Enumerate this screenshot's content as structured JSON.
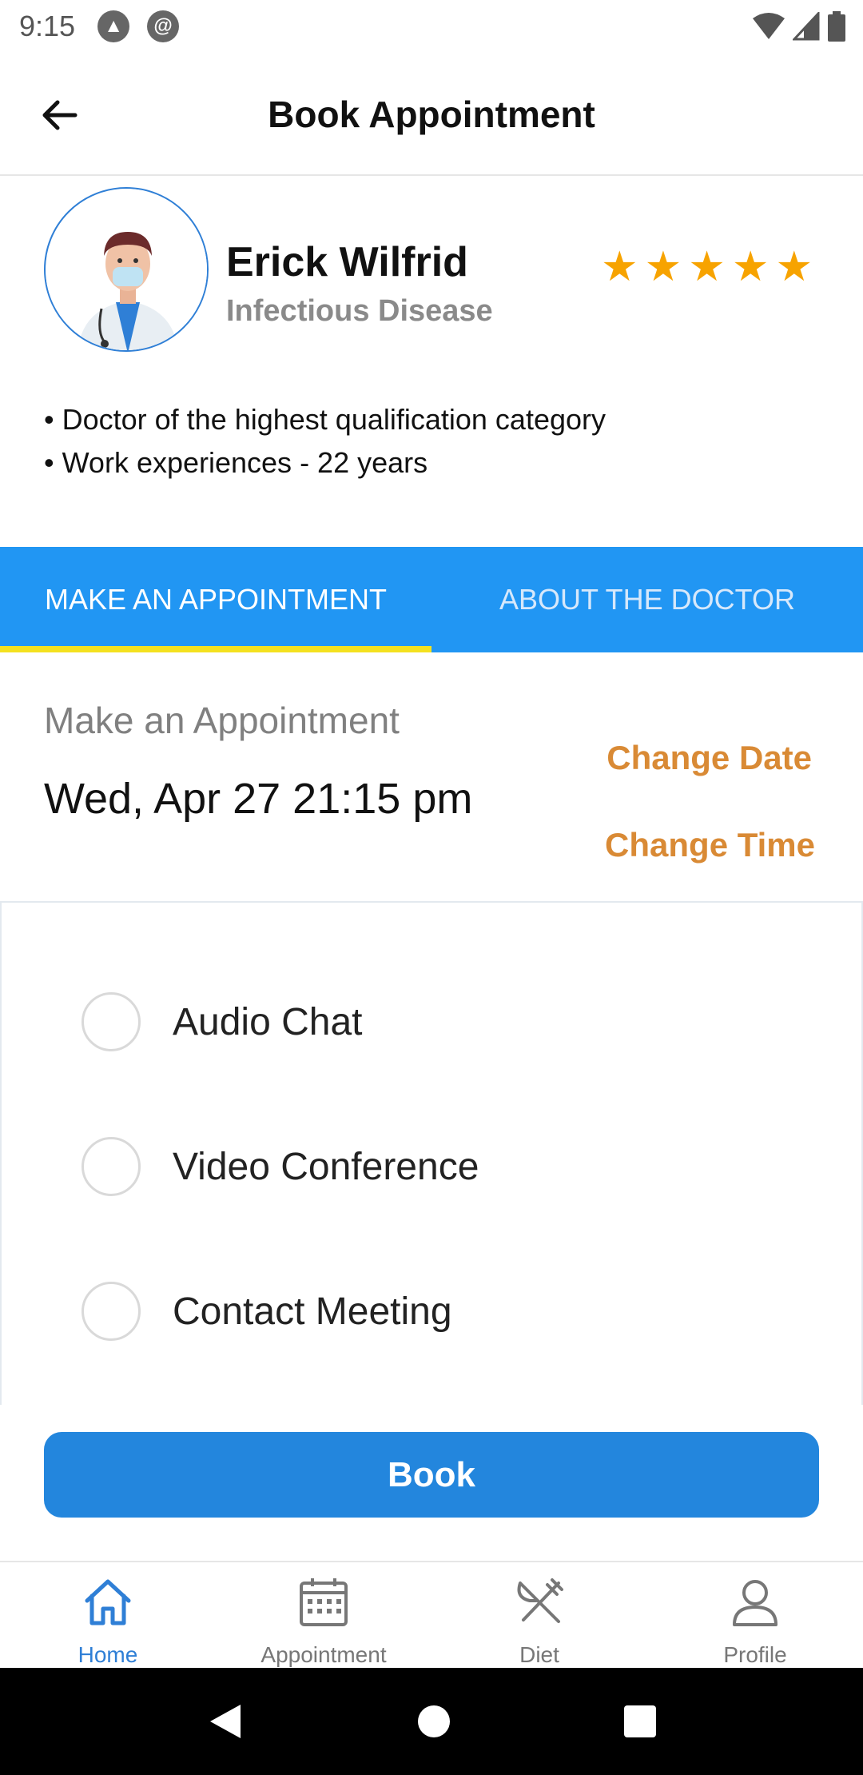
{
  "status_bar": {
    "time": "9:15"
  },
  "header": {
    "title": "Book Appointment"
  },
  "doctor": {
    "name": "Erick Wilfrid",
    "specialty": "Infectious Disease",
    "rating": 5,
    "bullets": [
      "• Doctor of the highest qualification category",
      "• Work experiences - 22 years"
    ]
  },
  "tabs": [
    {
      "label": "MAKE AN APPOINTMENT",
      "selected": true
    },
    {
      "label": "ABOUT THE DOCTOR",
      "selected": false
    }
  ],
  "appointment": {
    "heading": "Make an Appointment",
    "datetime": "Wed, Apr 27 21:15 pm",
    "change_date": "Change Date",
    "change_time": "Change Time"
  },
  "options": [
    {
      "label": "Audio Chat",
      "selected": false
    },
    {
      "label": "Video Conference",
      "selected": false
    },
    {
      "label": "Contact Meeting",
      "selected": false
    }
  ],
  "book_button": {
    "label": "Book"
  },
  "bottom_nav": [
    {
      "label": "Home",
      "icon": "home-icon",
      "active": true
    },
    {
      "label": "Appointment",
      "icon": "calendar-icon",
      "active": false
    },
    {
      "label": "Diet",
      "icon": "utensils-icon",
      "active": false
    },
    {
      "label": "Profile",
      "icon": "person-icon",
      "active": false
    }
  ],
  "colors": {
    "primary": "#2196f3",
    "button": "#2386dd",
    "accent_orange": "#d98a35",
    "star": "#f7a300",
    "tab_indicator": "#f4e11f"
  }
}
